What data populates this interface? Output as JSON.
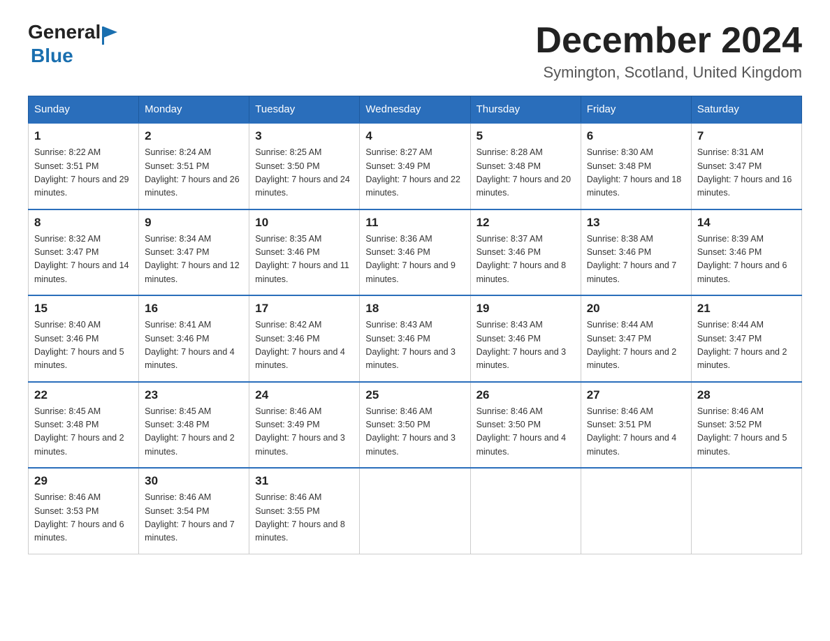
{
  "header": {
    "logo_general": "General",
    "logo_blue": "Blue",
    "month_title": "December 2024",
    "location": "Symington, Scotland, United Kingdom"
  },
  "weekdays": [
    "Sunday",
    "Monday",
    "Tuesday",
    "Wednesday",
    "Thursday",
    "Friday",
    "Saturday"
  ],
  "weeks": [
    [
      {
        "day": "1",
        "sunrise": "8:22 AM",
        "sunset": "3:51 PM",
        "daylight": "7 hours and 29 minutes."
      },
      {
        "day": "2",
        "sunrise": "8:24 AM",
        "sunset": "3:51 PM",
        "daylight": "7 hours and 26 minutes."
      },
      {
        "day": "3",
        "sunrise": "8:25 AM",
        "sunset": "3:50 PM",
        "daylight": "7 hours and 24 minutes."
      },
      {
        "day": "4",
        "sunrise": "8:27 AM",
        "sunset": "3:49 PM",
        "daylight": "7 hours and 22 minutes."
      },
      {
        "day": "5",
        "sunrise": "8:28 AM",
        "sunset": "3:48 PM",
        "daylight": "7 hours and 20 minutes."
      },
      {
        "day": "6",
        "sunrise": "8:30 AM",
        "sunset": "3:48 PM",
        "daylight": "7 hours and 18 minutes."
      },
      {
        "day": "7",
        "sunrise": "8:31 AM",
        "sunset": "3:47 PM",
        "daylight": "7 hours and 16 minutes."
      }
    ],
    [
      {
        "day": "8",
        "sunrise": "8:32 AM",
        "sunset": "3:47 PM",
        "daylight": "7 hours and 14 minutes."
      },
      {
        "day": "9",
        "sunrise": "8:34 AM",
        "sunset": "3:47 PM",
        "daylight": "7 hours and 12 minutes."
      },
      {
        "day": "10",
        "sunrise": "8:35 AM",
        "sunset": "3:46 PM",
        "daylight": "7 hours and 11 minutes."
      },
      {
        "day": "11",
        "sunrise": "8:36 AM",
        "sunset": "3:46 PM",
        "daylight": "7 hours and 9 minutes."
      },
      {
        "day": "12",
        "sunrise": "8:37 AM",
        "sunset": "3:46 PM",
        "daylight": "7 hours and 8 minutes."
      },
      {
        "day": "13",
        "sunrise": "8:38 AM",
        "sunset": "3:46 PM",
        "daylight": "7 hours and 7 minutes."
      },
      {
        "day": "14",
        "sunrise": "8:39 AM",
        "sunset": "3:46 PM",
        "daylight": "7 hours and 6 minutes."
      }
    ],
    [
      {
        "day": "15",
        "sunrise": "8:40 AM",
        "sunset": "3:46 PM",
        "daylight": "7 hours and 5 minutes."
      },
      {
        "day": "16",
        "sunrise": "8:41 AM",
        "sunset": "3:46 PM",
        "daylight": "7 hours and 4 minutes."
      },
      {
        "day": "17",
        "sunrise": "8:42 AM",
        "sunset": "3:46 PM",
        "daylight": "7 hours and 4 minutes."
      },
      {
        "day": "18",
        "sunrise": "8:43 AM",
        "sunset": "3:46 PM",
        "daylight": "7 hours and 3 minutes."
      },
      {
        "day": "19",
        "sunrise": "8:43 AM",
        "sunset": "3:46 PM",
        "daylight": "7 hours and 3 minutes."
      },
      {
        "day": "20",
        "sunrise": "8:44 AM",
        "sunset": "3:47 PM",
        "daylight": "7 hours and 2 minutes."
      },
      {
        "day": "21",
        "sunrise": "8:44 AM",
        "sunset": "3:47 PM",
        "daylight": "7 hours and 2 minutes."
      }
    ],
    [
      {
        "day": "22",
        "sunrise": "8:45 AM",
        "sunset": "3:48 PM",
        "daylight": "7 hours and 2 minutes."
      },
      {
        "day": "23",
        "sunrise": "8:45 AM",
        "sunset": "3:48 PM",
        "daylight": "7 hours and 2 minutes."
      },
      {
        "day": "24",
        "sunrise": "8:46 AM",
        "sunset": "3:49 PM",
        "daylight": "7 hours and 3 minutes."
      },
      {
        "day": "25",
        "sunrise": "8:46 AM",
        "sunset": "3:50 PM",
        "daylight": "7 hours and 3 minutes."
      },
      {
        "day": "26",
        "sunrise": "8:46 AM",
        "sunset": "3:50 PM",
        "daylight": "7 hours and 4 minutes."
      },
      {
        "day": "27",
        "sunrise": "8:46 AM",
        "sunset": "3:51 PM",
        "daylight": "7 hours and 4 minutes."
      },
      {
        "day": "28",
        "sunrise": "8:46 AM",
        "sunset": "3:52 PM",
        "daylight": "7 hours and 5 minutes."
      }
    ],
    [
      {
        "day": "29",
        "sunrise": "8:46 AM",
        "sunset": "3:53 PM",
        "daylight": "7 hours and 6 minutes."
      },
      {
        "day": "30",
        "sunrise": "8:46 AM",
        "sunset": "3:54 PM",
        "daylight": "7 hours and 7 minutes."
      },
      {
        "day": "31",
        "sunrise": "8:46 AM",
        "sunset": "3:55 PM",
        "daylight": "7 hours and 8 minutes."
      },
      null,
      null,
      null,
      null
    ]
  ]
}
